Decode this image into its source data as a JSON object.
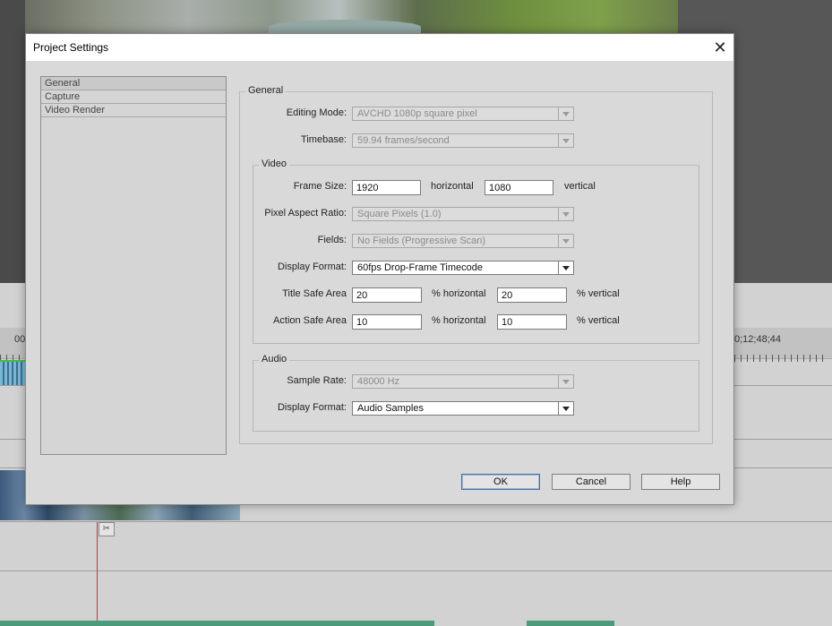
{
  "background": {
    "timecode_left": "00;",
    "timecode_right": "0;12;48;44"
  },
  "dialog": {
    "title": "Project Settings",
    "close_icon": "close-icon",
    "nav": [
      {
        "label": "General",
        "selected": true
      },
      {
        "label": "Capture",
        "selected": false
      },
      {
        "label": "Video Render",
        "selected": false
      }
    ],
    "general": {
      "group_label": "General",
      "editing_mode_label": "Editing Mode:",
      "editing_mode_value": "AVCHD 1080p square pixel",
      "timebase_label": "Timebase:",
      "timebase_value": "59.94 frames/second"
    },
    "video": {
      "group_label": "Video",
      "frame_size_label": "Frame Size:",
      "frame_width": "1920",
      "horizontal_label": "horizontal",
      "frame_height": "1080",
      "vertical_label": "vertical",
      "pixel_aspect_label": "Pixel Aspect Ratio:",
      "pixel_aspect_value": "Square Pixels (1.0)",
      "fields_label": "Fields:",
      "fields_value": "No Fields (Progressive Scan)",
      "display_format_label": "Display Format:",
      "display_format_value": "60fps Drop-Frame Timecode",
      "title_safe_label": "Title Safe Area",
      "title_safe_h": "20",
      "title_safe_h_unit": "% horizontal",
      "title_safe_v": "20",
      "title_safe_v_unit": "% vertical",
      "action_safe_label": "Action Safe Area",
      "action_safe_h": "10",
      "action_safe_h_unit": "% horizontal",
      "action_safe_v": "10",
      "action_safe_v_unit": "% vertical"
    },
    "audio": {
      "group_label": "Audio",
      "sample_rate_label": "Sample Rate:",
      "sample_rate_value": "48000 Hz",
      "display_format_label": "Display Format:",
      "display_format_value": "Audio Samples"
    },
    "buttons": {
      "ok": "OK",
      "cancel": "Cancel",
      "help": "Help"
    }
  }
}
